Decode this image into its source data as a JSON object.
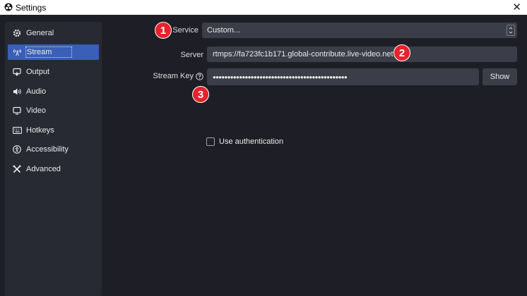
{
  "window": {
    "title": "Settings",
    "close_glyph": "✕"
  },
  "sidebar": {
    "items": [
      {
        "label": "General",
        "icon": "gear-icon"
      },
      {
        "label": "Stream",
        "icon": "antenna-icon",
        "active": true
      },
      {
        "label": "Output",
        "icon": "output-icon"
      },
      {
        "label": "Audio",
        "icon": "speaker-icon"
      },
      {
        "label": "Video",
        "icon": "monitor-icon"
      },
      {
        "label": "Hotkeys",
        "icon": "keyboard-icon"
      },
      {
        "label": "Accessibility",
        "icon": "accessibility-icon"
      },
      {
        "label": "Advanced",
        "icon": "wrench-icon"
      }
    ]
  },
  "stream": {
    "service_label": "Service",
    "service_value": "Custom...",
    "server_label": "Server",
    "server_value": "rtmps://fa723fc1b171.global-contribute.live-video.net",
    "stream_key_label": "Stream Key",
    "stream_key_value": "●●●●●●●●●●●●●●●●●●●●●●●●●●●●●●●●●●●●●●●●●●●●●●",
    "show_button": "Show",
    "use_auth_label": "Use authentication",
    "use_auth_checked": false
  },
  "annotations": [
    {
      "number": "1"
    },
    {
      "number": "2"
    },
    {
      "number": "3"
    }
  ],
  "colors": {
    "background": "#1e1f26",
    "sidebar": "#272a33",
    "active_item": "#3a5fb8",
    "field": "#3b3e48",
    "badge": "#e8222b"
  }
}
